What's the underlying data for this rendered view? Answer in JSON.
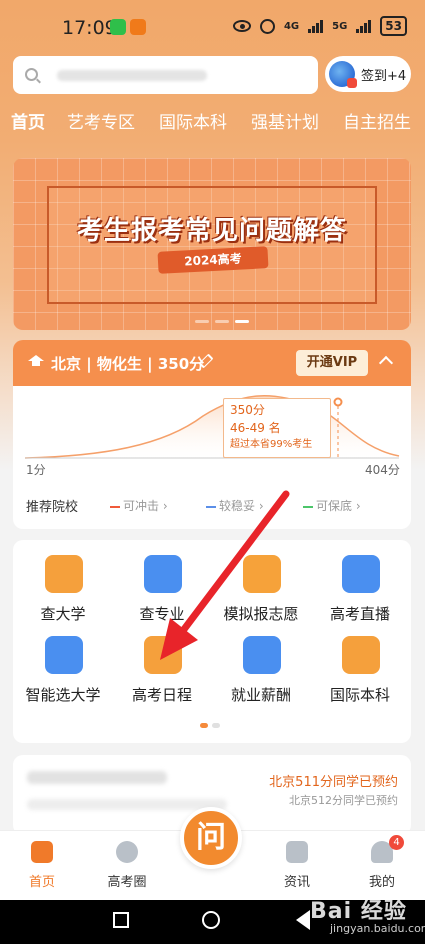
{
  "status_bar": {
    "time": "17:09",
    "network_1": "4G",
    "network_2": "5G",
    "battery": "53"
  },
  "search": {
    "placeholder": ""
  },
  "signin": {
    "label": "签到+4"
  },
  "tabs": [
    "首页",
    "艺考专区",
    "国际本科",
    "强基计划",
    "自主招生"
  ],
  "banner": {
    "title": "考生报考常见问题解答",
    "ribbon": "2024高考"
  },
  "score_card": {
    "info": "北京 | 物化生 | 350分",
    "vip_label": "开通VIP",
    "tooltip": {
      "score": "350分",
      "rank": "46-49 名",
      "note": "超过本省99%考生"
    },
    "axis_min": "1分",
    "axis_max": "404分",
    "recommend_label": "推荐院校",
    "legend": [
      {
        "label": "可冲击 ›",
        "color": "#f05a3a"
      },
      {
        "label": "较稳妥 ›",
        "color": "#5b8fe8"
      },
      {
        "label": "可保底 ›",
        "color": "#4cc56a"
      }
    ]
  },
  "grid": {
    "items": [
      {
        "label": "查大学",
        "icon": "university-icon",
        "color": "#f5a03c"
      },
      {
        "label": "查专业",
        "icon": "major-search-icon",
        "color": "#4a8ff0"
      },
      {
        "label": "模拟报志愿",
        "icon": "ai-application-icon",
        "color": "#f6a23a"
      },
      {
        "label": "高考直播",
        "icon": "live-icon",
        "color": "#4a8ff0"
      },
      {
        "label": "智能选大学",
        "icon": "smart-select-icon",
        "color": "#4a8ff0"
      },
      {
        "label": "高考日程",
        "icon": "calendar-icon",
        "color": "#f5a03c"
      },
      {
        "label": "就业薪酬",
        "icon": "salary-icon",
        "color": "#4a8ff0"
      },
      {
        "label": "国际本科",
        "icon": "international-icon",
        "color": "#f5a03c"
      }
    ]
  },
  "news": {
    "line1": "北京511分同学已预约",
    "line2": "北京512分同学已预约"
  },
  "bottom_nav": {
    "items": [
      {
        "label": "首页"
      },
      {
        "label": "高考圈"
      },
      {
        "label": "资讯"
      },
      {
        "label": "我的"
      }
    ],
    "ask_label": "问",
    "badge": "4"
  },
  "watermark": {
    "brand": "Bai 经验",
    "url": "jingyan.baidu.com"
  }
}
